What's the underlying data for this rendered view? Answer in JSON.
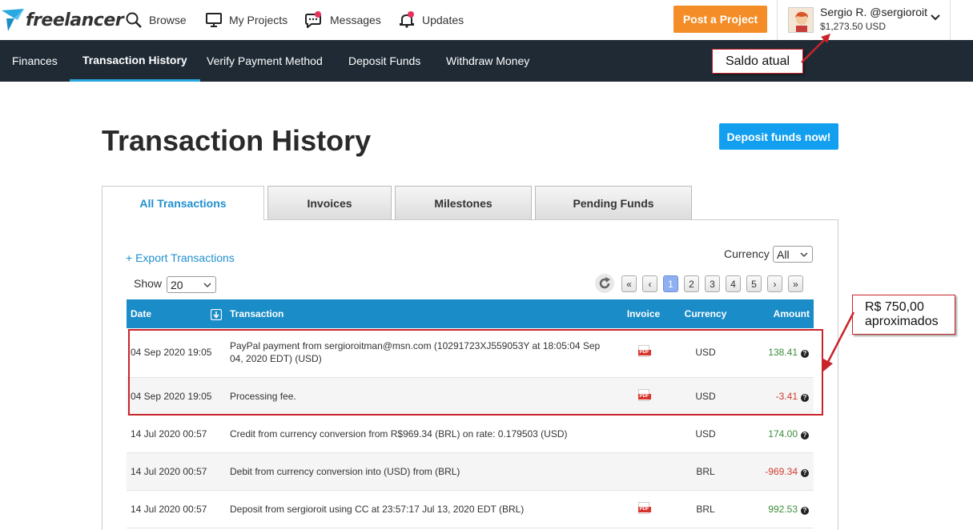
{
  "topbar": {
    "logo_text": "freelancer",
    "nav": {
      "browse": "Browse",
      "projects": "My Projects",
      "messages": "Messages",
      "updates": "Updates"
    },
    "post_project": "Post a Project",
    "user": {
      "name": "Sergio R. @sergioroit",
      "balance": "$1,273.50 USD"
    }
  },
  "subnav": {
    "finances": "Finances",
    "transaction_history": "Transaction History",
    "verify": "Verify Payment Method",
    "deposit": "Deposit Funds",
    "withdraw": "Withdraw Money"
  },
  "annotations": {
    "balance_note": "Saldo atual",
    "amount_note_line1": "R$ 750,00",
    "amount_note_line2": "aproximados"
  },
  "page_title": "Transaction History",
  "deposit_now": "Deposit funds now!",
  "tabs": [
    "All Transactions",
    "Invoices",
    "Milestones",
    "Pending Funds"
  ],
  "export_label": "+ Export Transactions",
  "currency_label": "Currency",
  "currency_value": "All",
  "show_label": "Show",
  "show_value": "20",
  "pager": {
    "first": "«",
    "prev": "‹",
    "pages": [
      "1",
      "2",
      "3",
      "4",
      "5"
    ],
    "next": "›",
    "last": "»"
  },
  "table": {
    "headers": {
      "date": "Date",
      "transaction": "Transaction",
      "invoice": "Invoice",
      "currency": "Currency",
      "amount": "Amount"
    },
    "pdf_label": "PDF",
    "rows": [
      {
        "date": "04 Sep 2020 19:05",
        "transaction": "PayPal payment from sergioroitman@msn.com (10291723XJ559053Y at 18:05:04 Sep 04, 2020 EDT) (USD)",
        "currency": "USD",
        "amount": "138.41"
      },
      {
        "date": "04 Sep 2020 19:05",
        "transaction": "Processing fee.",
        "currency": "USD",
        "amount": "-3.41"
      },
      {
        "date": "14 Jul 2020 00:57",
        "transaction": "Credit from currency conversion from R$969.34 (BRL) on rate: 0.179503 (USD)",
        "currency": "USD",
        "amount": "174.00"
      },
      {
        "date": "14 Jul 2020 00:57",
        "transaction": "Debit from currency conversion into (USD) from (BRL)",
        "currency": "BRL",
        "amount": "-969.34"
      },
      {
        "date": "14 Jul 2020 00:57",
        "transaction": "Deposit from sergioroit using CC at 23:57:17 Jul 13, 2020 EDT (BRL)",
        "currency": "BRL",
        "amount": "992.53"
      }
    ]
  },
  "colors": {
    "accent": "#1a8cc7",
    "orange": "#f48d27",
    "nav_dark": "#1f2a35",
    "annotation_red": "#c9242b"
  }
}
